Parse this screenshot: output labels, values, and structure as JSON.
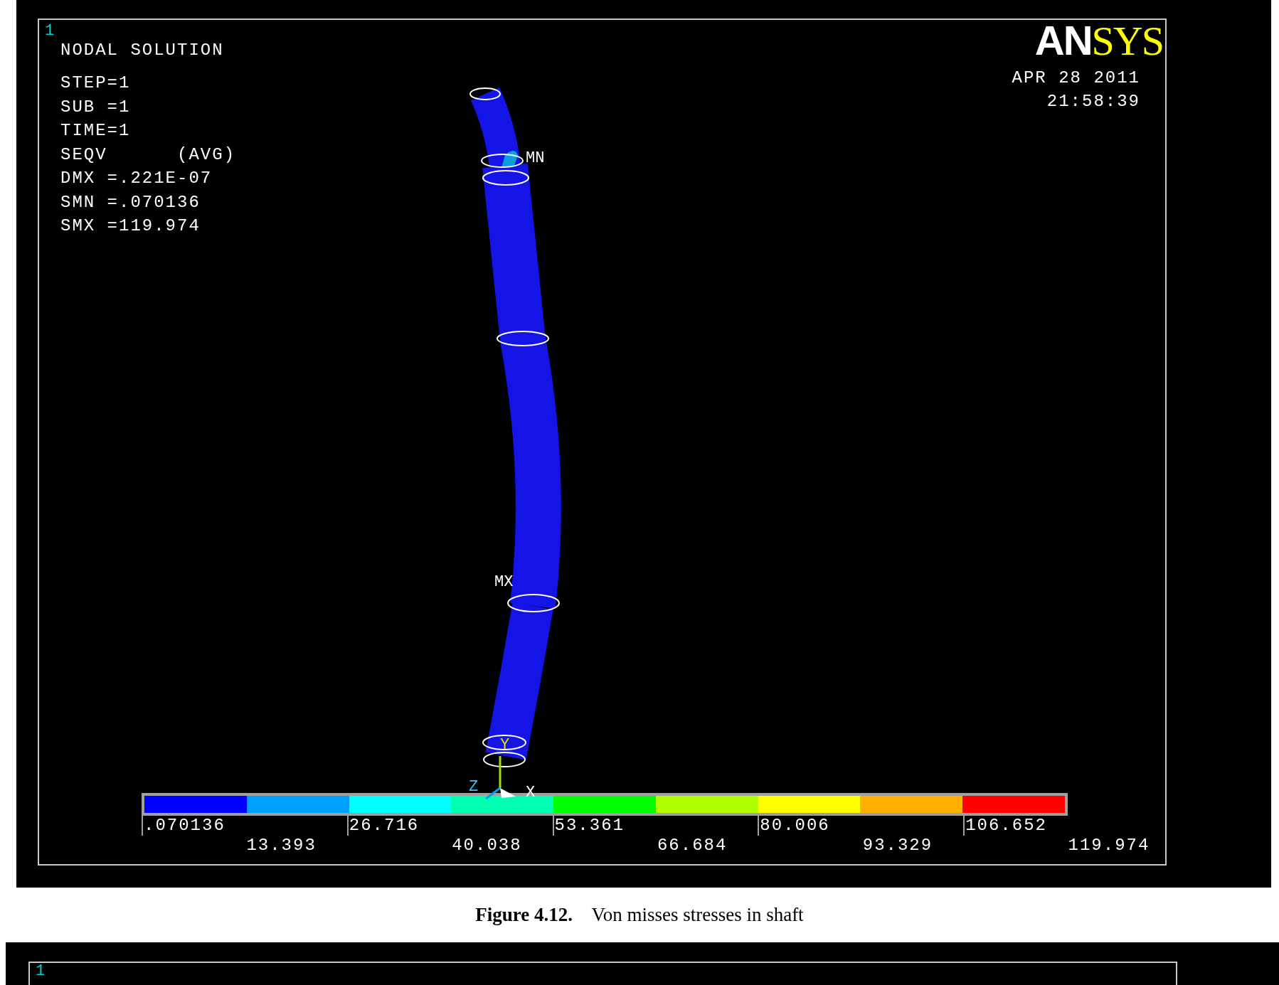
{
  "figure_1": {
    "window_number": "1",
    "title": "NODAL SOLUTION",
    "info_lines": [
      "STEP=1",
      "SUB =1",
      "TIME=1",
      "SEQV      (AVG)",
      "DMX =.221E-07",
      "SMN =.070136",
      "SMX =119.974"
    ],
    "logo": [
      "AN",
      "SYS"
    ],
    "date": "APR 28 2011",
    "time": "21:58:39",
    "model_labels": {
      "min": "MN",
      "max": "MX"
    },
    "axes": {
      "y": "Y",
      "z": "Z",
      "x": "X"
    },
    "legend_bands": [
      {
        "color": "#0000ff"
      },
      {
        "color": "#00a0ff"
      },
      {
        "color": "#00ffff"
      },
      {
        "color": "#00ffb0"
      },
      {
        "color": "#00ff00"
      },
      {
        "color": "#b0ff00"
      },
      {
        "color": "#ffff00"
      },
      {
        "color": "#ffb000"
      },
      {
        "color": "#ff0000"
      }
    ],
    "legend_labels": [
      ".070136",
      "13.393",
      "26.716",
      "40.038",
      "53.361",
      "66.684",
      "80.006",
      "93.329",
      "106.652",
      "119.974"
    ]
  },
  "caption": "**Figure 4.12.**    Von misses stresses in shaft",
  "figure_2": {
    "window_number": "1"
  }
}
